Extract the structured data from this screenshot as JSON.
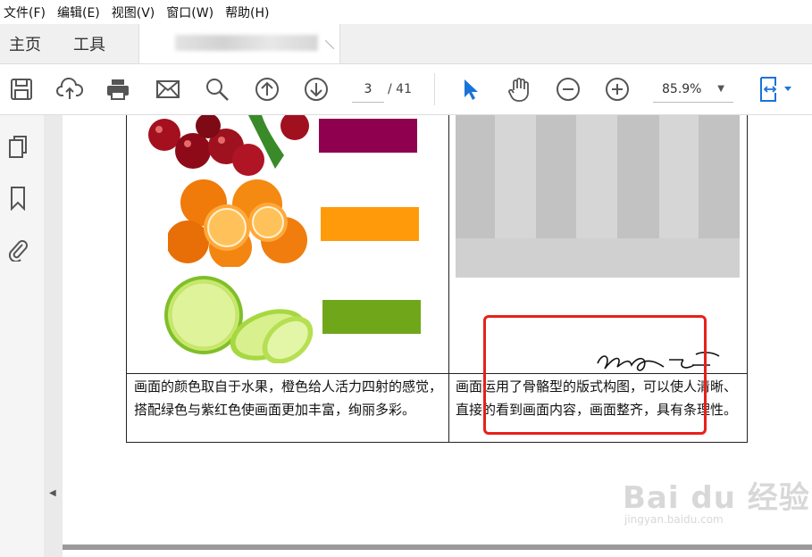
{
  "menu": [
    "文件(F)",
    "编辑(E)",
    "视图(V)",
    "窗口(W)",
    "帮助(H)"
  ],
  "tabs": {
    "home": "主页",
    "tools": "工具"
  },
  "toolbar": {
    "page_current": "3",
    "page_total": "/ 41",
    "zoom": "85.9%"
  },
  "document": {
    "left_caption": "画面的颜色取自于水果，橙色给人活力四射的感觉，搭配绿色与紫红色使画面更加丰富，绚丽多彩。",
    "right_caption": "画面运用了骨骼型的版式构图，可以使人清晰、直接的看到画面内容，画面整齐，具有条理性。"
  },
  "colors": {
    "swatch_cherry": "#8f004e",
    "swatch_orange": "#ff9a0a",
    "swatch_lime": "#70a71a",
    "accent_blue": "#1a73d9",
    "highlight_red": "#e8201a"
  },
  "watermark": {
    "brand": "Bai du 经验",
    "url": "jingyan.baidu.com"
  }
}
